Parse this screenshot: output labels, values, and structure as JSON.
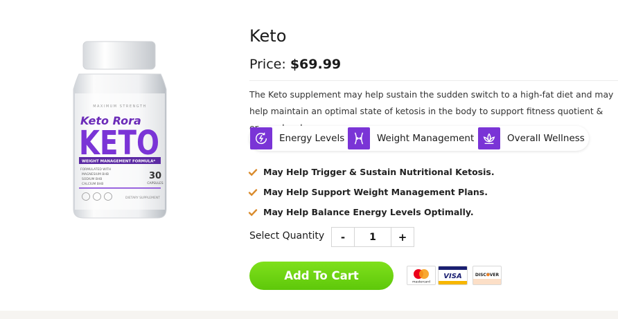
{
  "product": {
    "title": "Keto",
    "price_label": "Price:",
    "price_value": "$69.99",
    "description": "The Keto supplement may help sustain the sudden switch to a high-fat diet and may help maintain an optimal state of ketosis in the body to support fitness quotient & energy levels.",
    "image": {
      "brand_top": "MAXIMUM STRENGTH",
      "brand": "Keto Rora",
      "big_word": "KETO",
      "band": "WEIGHT MANAGEMENT FORMULA*",
      "formulated": "FORMULATED WITH",
      "ingredients": [
        "MAGNESIUM BHB",
        "SODIUM BHB",
        "CALCIUM BHB"
      ],
      "count": "30",
      "count_unit": "CAPSULES",
      "footer": "DIETARY SUPPLEMENT"
    }
  },
  "features": [
    {
      "label": "Energy Levels",
      "icon": "energy-icon"
    },
    {
      "label": "Weight Management",
      "icon": "waist-icon"
    },
    {
      "label": "Overall Wellness",
      "icon": "lotus-icon"
    }
  ],
  "benefits": [
    "May Help Trigger & Sustain Nutritional Ketosis.",
    "May Help Support Weight Management Plans.",
    "May Help Balance Energy Levels Optimally."
  ],
  "quantity": {
    "label": "Select Quantity",
    "minus": "-",
    "value": "1",
    "plus": "+"
  },
  "cart_button": "Add To Cart",
  "payment_cards": {
    "mastercard": "mastercard",
    "visa": "VISA",
    "discover": "DISCOVER"
  },
  "colors": {
    "accent_purple": "#7a34d6",
    "cart_green": "#64cc10",
    "check_orange": "#d98a2b"
  }
}
